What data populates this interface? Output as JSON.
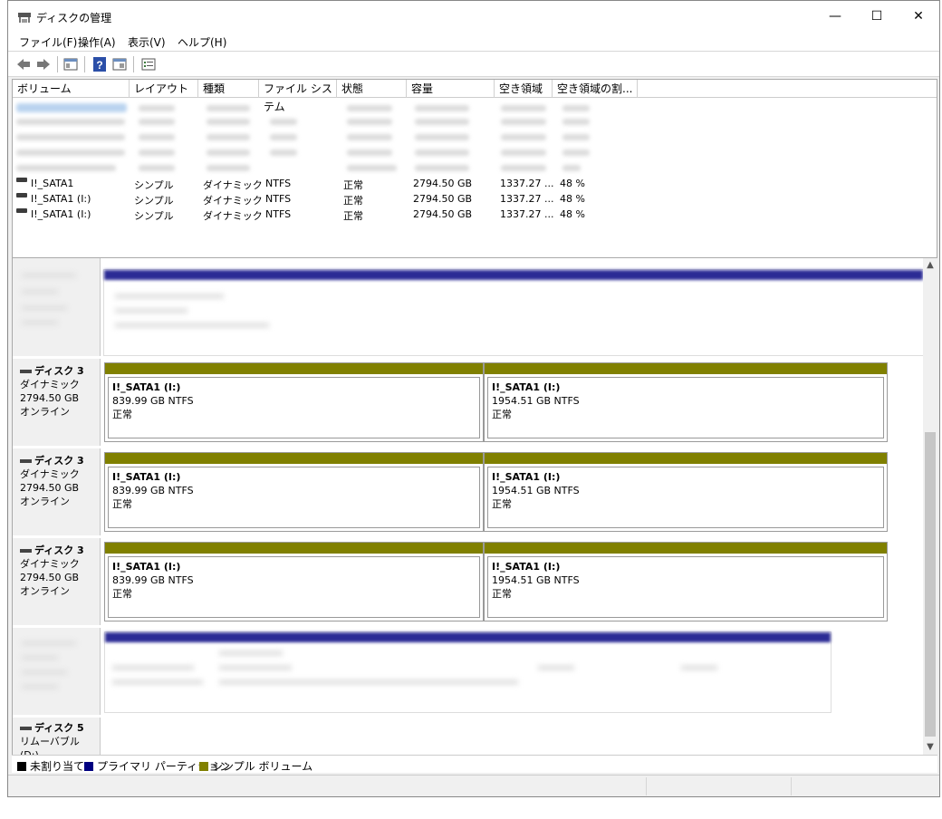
{
  "window": {
    "title": "ディスクの管理",
    "controls": {
      "minimize": "—",
      "maximize": "☐",
      "close": "✕"
    }
  },
  "menu": [
    "ファイル(F)",
    "操作(A)",
    "表示(V)",
    "ヘルプ(H)"
  ],
  "toolbar_icons": [
    "back-icon",
    "forward-icon",
    "console-tree-icon",
    "help-icon",
    "properties-icon",
    "checklist-icon"
  ],
  "volume_list": {
    "columns": [
      "ボリューム",
      "レイアウト",
      "種類",
      "ファイル システム",
      "状態",
      "容量",
      "空き領域",
      "空き領域の割..."
    ],
    "rows": [
      {
        "name": "I!_SATA1",
        "layout": "シンプル",
        "type": "ダイナミック",
        "fs": "NTFS",
        "status": "正常",
        "capacity": "2794.50 GB",
        "free": "1337.27 ...",
        "pct": "48 %"
      },
      {
        "name": "I!_SATA1 (I:)",
        "layout": "シンプル",
        "type": "ダイナミック",
        "fs": "NTFS",
        "status": "正常",
        "capacity": "2794.50 GB",
        "free": "1337.27 ...",
        "pct": "48 %"
      },
      {
        "name": "I!_SATA1 (I:)",
        "layout": "シンプル",
        "type": "ダイナミック",
        "fs": "NTFS",
        "status": "正常",
        "capacity": "2794.50 GB",
        "free": "1337.27 ...",
        "pct": "48 %"
      }
    ]
  },
  "disks": [
    {
      "name": "ディスク 3",
      "type": "ダイナミック",
      "size": "2794.50 GB",
      "state": "オンライン",
      "partitions": [
        {
          "name": "I!_SATA1  (I:)",
          "size": "839.99 GB NTFS",
          "status": "正常"
        },
        {
          "name": "I!_SATA1  (I:)",
          "size": "1954.51 GB NTFS",
          "status": "正常"
        }
      ]
    },
    {
      "name": "ディスク 3",
      "type": "ダイナミック",
      "size": "2794.50 GB",
      "state": "オンライン",
      "partitions": [
        {
          "name": "I!_SATA1  (I:)",
          "size": "839.99 GB NTFS",
          "status": "正常"
        },
        {
          "name": "I!_SATA1  (I:)",
          "size": "1954.51 GB NTFS",
          "status": "正常"
        }
      ]
    },
    {
      "name": "ディスク 3",
      "type": "ダイナミック",
      "size": "2794.50 GB",
      "state": "オンライン",
      "partitions": [
        {
          "name": "I!_SATA1  (I:)",
          "size": "839.99 GB NTFS",
          "status": "正常"
        },
        {
          "name": "I!_SATA1  (I:)",
          "size": "1954.51 GB NTFS",
          "status": "正常"
        }
      ]
    }
  ],
  "removable_disk": {
    "name": "ディスク 5",
    "type": "リムーバブル (D:)"
  },
  "legend": [
    {
      "label": "未割り当て",
      "color": "#000000"
    },
    {
      "label": "プライマリ パーティション",
      "color": "#000080"
    },
    {
      "label": "シンプル ボリューム",
      "color": "#808000"
    }
  ],
  "colors": {
    "simple_volume": "#808000",
    "primary_partition": "#1c1c8c"
  }
}
